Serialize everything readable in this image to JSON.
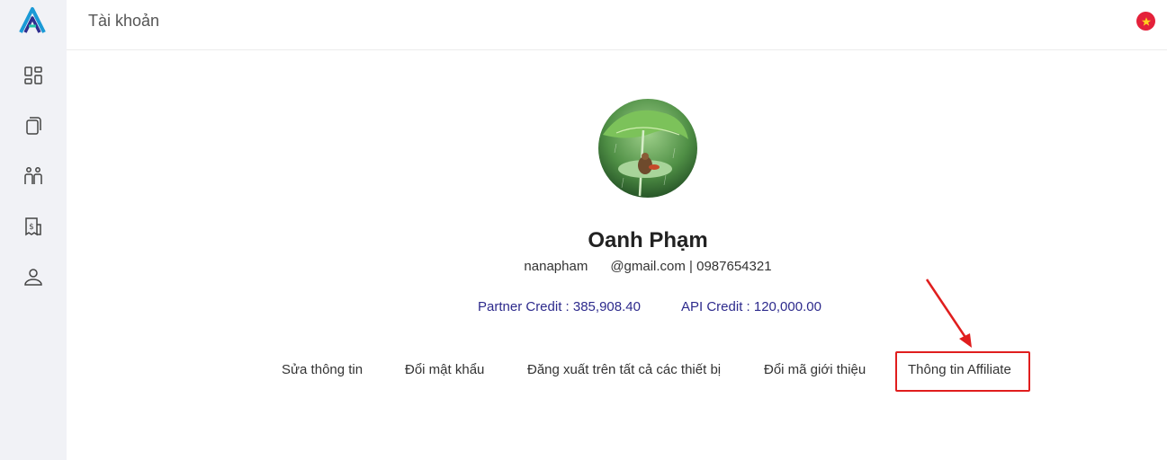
{
  "header": {
    "title": "Tài khoản",
    "language_icon": "vietnam-flag-icon",
    "flag_color": "#e4213a"
  },
  "sidebar": {
    "logo_icon": "app-logo",
    "items": [
      {
        "icon": "dashboard-icon"
      },
      {
        "icon": "documents-icon"
      },
      {
        "icon": "users-icon"
      },
      {
        "icon": "billing-icon"
      },
      {
        "icon": "user-profile-icon"
      }
    ]
  },
  "profile": {
    "name": "Oanh Phạm",
    "contact": "nanapham      @gmail.com | 0987654321",
    "partner_credit": "Partner Credit : 385,908.40",
    "api_credit": "API Credit : 120,000.00"
  },
  "actions": {
    "edit_info": "Sửa thông tin",
    "change_password": "Đổi mật khẩu",
    "logout_all": "Đăng xuất trên tất cả các thiết bị",
    "change_referral": "Đổi mã giới thiệu",
    "affiliate_info": "Thông tin Affiliate"
  },
  "colors": {
    "accent": "#2d2a8c",
    "annotation": "#e01e1e",
    "sidebar_bg": "#f1f2f6"
  }
}
